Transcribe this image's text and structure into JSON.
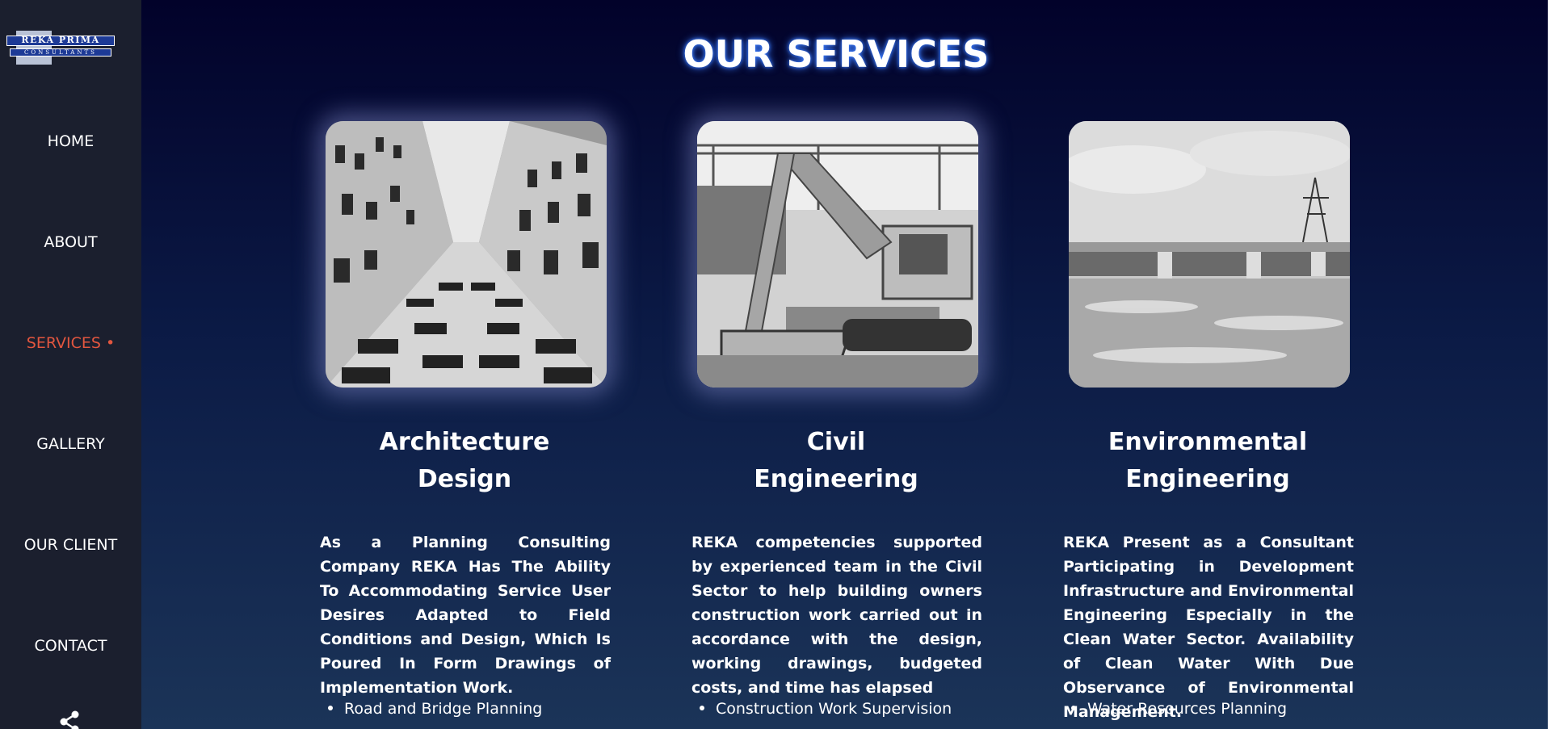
{
  "sidebar": {
    "logo": {
      "name": "REKA PRIMA",
      "sub": "CONSULTANTS"
    },
    "items": [
      {
        "label": "HOME"
      },
      {
        "label": "ABOUT"
      },
      {
        "label": "SERVICES •"
      },
      {
        "label": "GALLERY"
      },
      {
        "label": "OUR CLIENT"
      },
      {
        "label": "CONTACT"
      }
    ],
    "active_color": "#e2563f",
    "share_icon": "share-icon"
  },
  "main": {
    "title": "OUR SERVICES",
    "cards": [
      {
        "title_line1": "Architecture",
        "title_line2": "Design",
        "description": "As a Planning Consulting Company REKA Has The Ability To Accommodating Service User Desires Adapted to Field Conditions and Design, Which Is Poured In Form Drawings of Implementation Work.",
        "bullet": "Road and Bridge Planning",
        "image_icon": "building-photo"
      },
      {
        "title_line1": "Civil",
        "title_line2": "Engineering",
        "description": "REKA competencies supported by experienced team in the Civil Sector to help building owners construction work carried out in accordance with the design, working drawings, budgeted costs, and time has elapsed",
        "bullet": "Construction Work Supervision",
        "image_icon": "excavator-photo"
      },
      {
        "title_line1": "Environmental",
        "title_line2": "Engineering",
        "description": "REKA Present as a Consultant Participating in Development Infrastructure and Environmental Engineering Especially in the Clean Water Sector. Availability of Clean Water With Due Observance of Environmental Management.",
        "bullet": "Water Resources Planning",
        "image_icon": "dam-photo"
      }
    ]
  }
}
